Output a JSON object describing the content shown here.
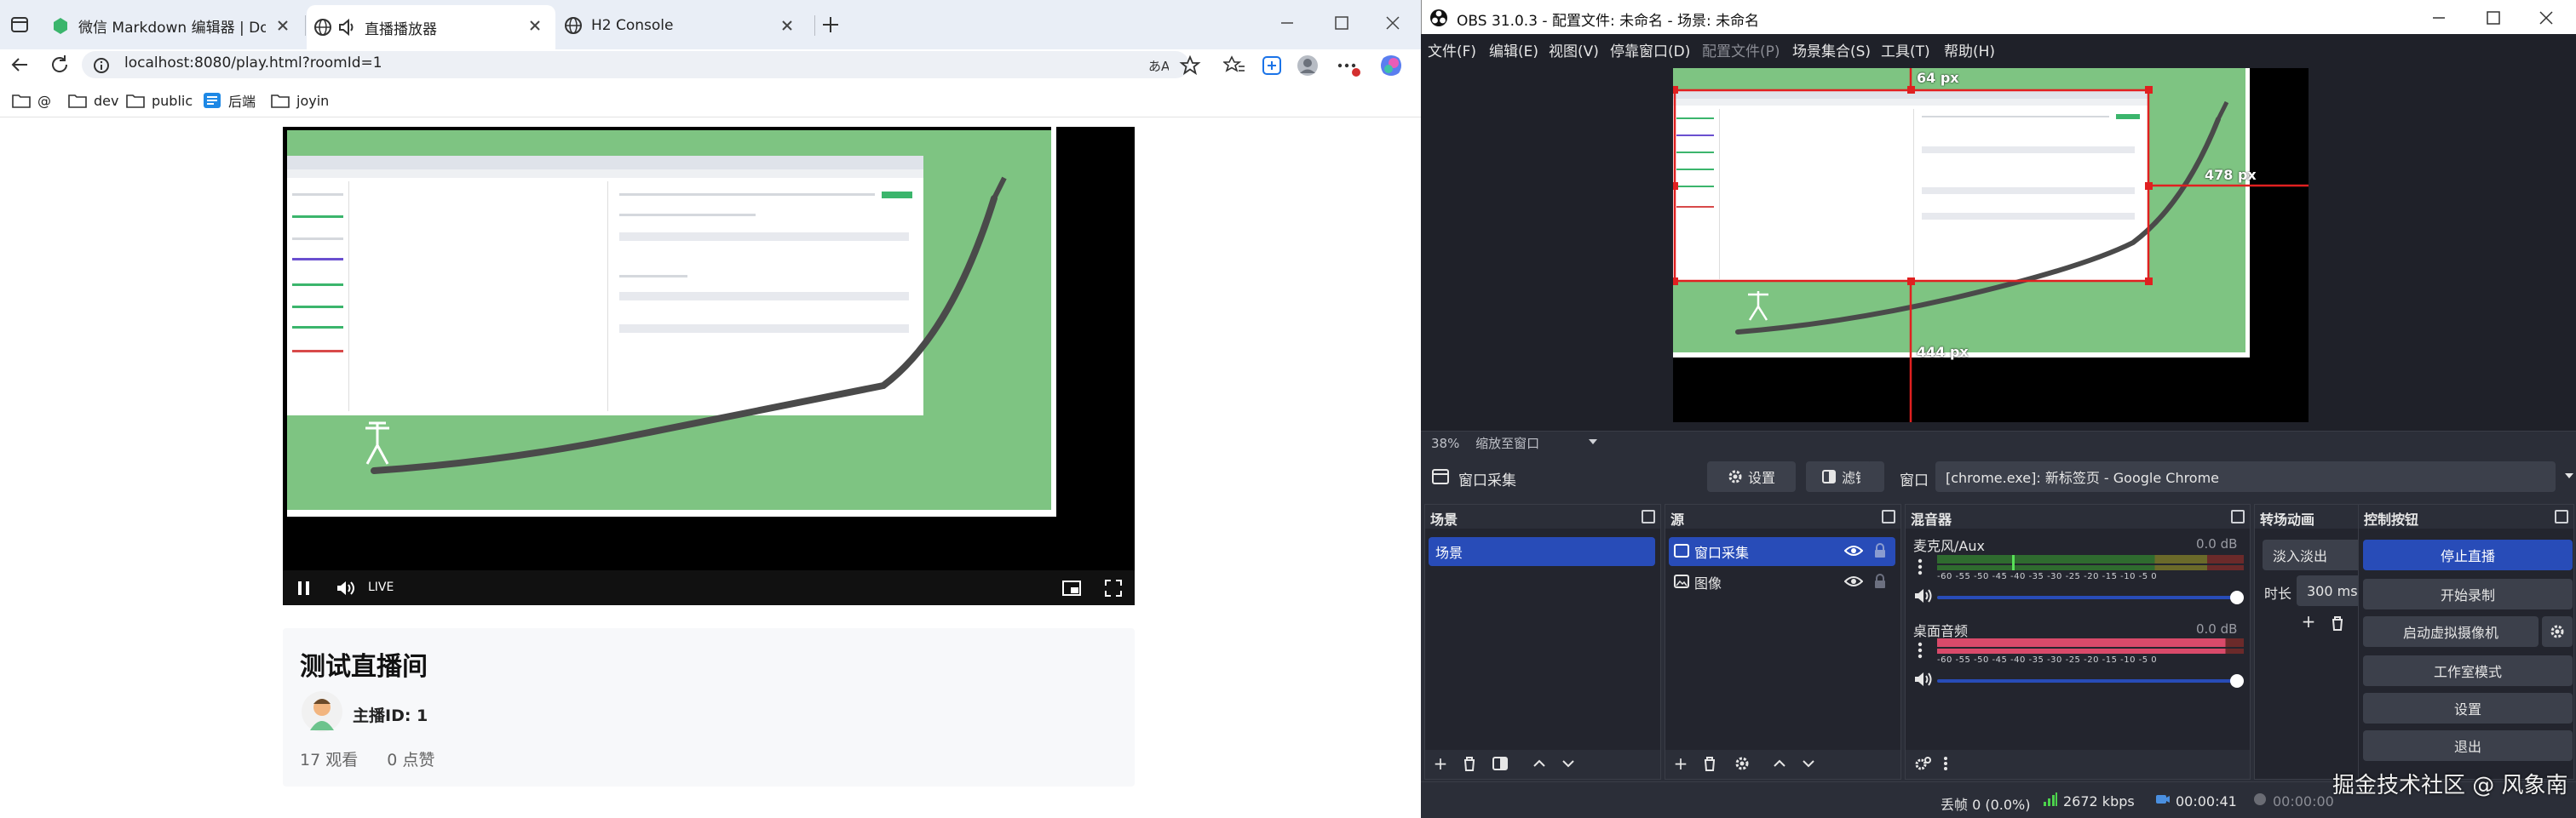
{
  "browser": {
    "tabs": [
      {
        "label": "微信 Markdown 编辑器 | Doocs 开源社区",
        "active": false
      },
      {
        "label": "直播播放器",
        "active": true
      },
      {
        "label": "H2 Console",
        "active": false
      }
    ],
    "url": "localhost:8080/play.html?roomId=1",
    "bookmarks": [
      "@",
      "dev",
      "public",
      "后端",
      "joyin"
    ],
    "video": {
      "live_label": "LIVE"
    },
    "room": {
      "title": "测试直播间",
      "host_label": "主播ID: 1",
      "views": "17 观看",
      "likes": "0 点赞"
    }
  },
  "obs": {
    "title": "OBS 31.0.3 - 配置文件: 未命名 - 场景: 未命名",
    "menu": [
      {
        "label": "文件(F)",
        "disabled": false
      },
      {
        "label": "编辑(E)",
        "disabled": false
      },
      {
        "label": "视图(V)",
        "disabled": false
      },
      {
        "label": "停靠窗口(D)",
        "disabled": false
      },
      {
        "label": "配置文件(P)",
        "disabled": true
      },
      {
        "label": "场景集合(S)",
        "disabled": false
      },
      {
        "label": "工具(T)",
        "disabled": false
      },
      {
        "label": "帮助(H)",
        "disabled": false
      }
    ],
    "preview": {
      "measure_top": "64 px",
      "measure_right": "478 px",
      "measure_bottom": "444 px"
    },
    "zoom": {
      "level": "38%",
      "mode": "缩放至窗口"
    },
    "source_bar": {
      "source_name": "窗口采集",
      "settings_label": "设置",
      "filters_label": "滤镜",
      "window_label": "窗口",
      "window_value": "[chrome.exe]: 新标签页 - Google Chrome"
    },
    "docks": {
      "scenes": {
        "title": "场景",
        "items": [
          "场景"
        ]
      },
      "sources": {
        "title": "源",
        "items": [
          "窗口采集",
          "图像"
        ]
      },
      "mixer": {
        "title": "混音器",
        "channels": [
          {
            "name": "麦克风/Aux",
            "db": "0.0 dB"
          },
          {
            "name": "桌面音频",
            "db": "0.0 dB"
          }
        ],
        "ticks": "-60 -55 -50 -45 -40 -35 -30 -25 -20 -15 -10 -5 0"
      },
      "transitions": {
        "title": "转场动画",
        "type": "淡入淡出",
        "duration_label": "时长",
        "duration_value": "300 ms"
      },
      "controls": {
        "title": "控制按钮",
        "buttons": [
          "停止直播",
          "开始录制",
          "启动虚拟摄像机",
          "工作室模式",
          "设置",
          "退出"
        ]
      }
    },
    "status": {
      "dropped": "丢帧 0 (0.0%)",
      "bitrate": "2672 kbps",
      "stream_time": "00:00:41",
      "rec_time": "00:00:00"
    },
    "colors": {
      "accent": "#284cb8",
      "green": "#7ec482",
      "red_frame": "#e02020"
    }
  },
  "watermark": "掘金技术社区 @ 风象南"
}
